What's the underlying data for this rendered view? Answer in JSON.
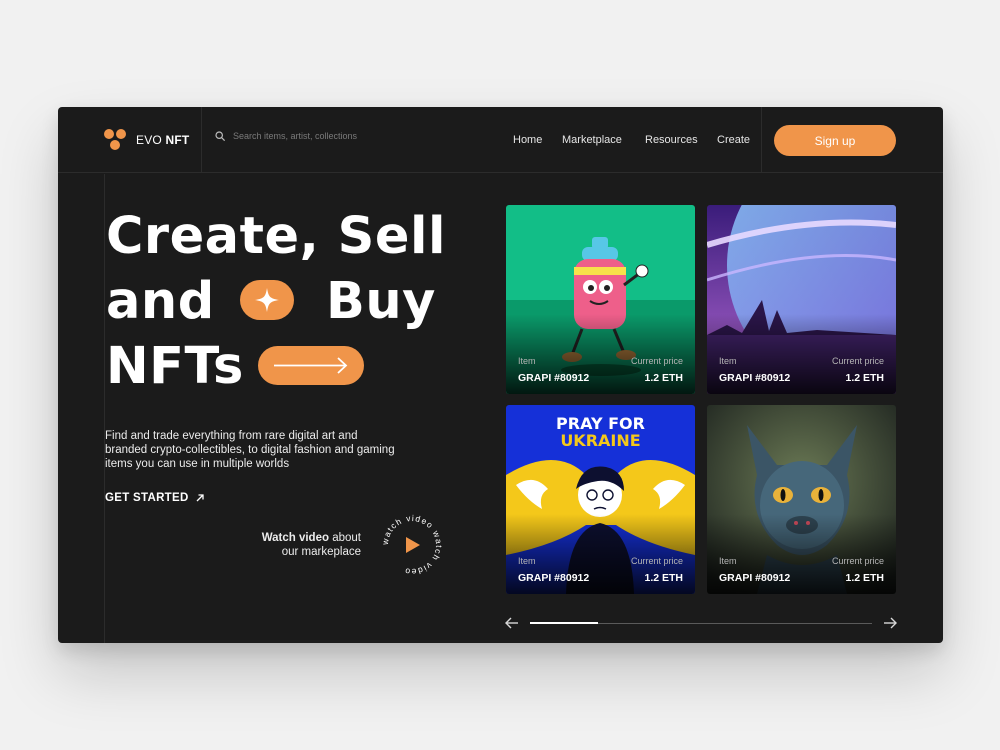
{
  "brand": {
    "name_light": "EVO",
    "name_bold": "NFT",
    "accent": "#f0954a"
  },
  "search": {
    "placeholder": "Search items, artist, collections"
  },
  "nav": {
    "items": [
      "Home",
      "Marketplace",
      "Resources",
      "Create"
    ]
  },
  "header": {
    "signup_label": "Sign up"
  },
  "hero": {
    "line1": "Create, Sell",
    "line2a": "and",
    "line2b": "Buy",
    "line3": "NFTs",
    "description": "Find and trade everything from rare digital art and branded crypto-collectibles, to digital fashion and gaming items you can use in multiple worlds",
    "cta_label": "GET STARTED",
    "watch_bold": "Watch video",
    "watch_rest": "about",
    "watch_line2": "our markeplace",
    "badge_text": "watch video watch video"
  },
  "cards": [
    {
      "item_label": "Item",
      "price_label": "Current price",
      "name": "GRAPI #80912",
      "price": "1.2 ETH",
      "bg": "#12be87"
    },
    {
      "item_label": "Item",
      "price_label": "Current price",
      "name": "GRAPI #80912",
      "price": "1.2 ETH",
      "bg": "#5a2d8a"
    },
    {
      "item_label": "Item",
      "price_label": "Current price",
      "name": "GRAPI #80912",
      "price": "1.2 ETH",
      "bg": "#1530d8",
      "poster_line1": "PRAY FOR",
      "poster_line2": "UKRAINE"
    },
    {
      "item_label": "Item",
      "price_label": "Current price",
      "name": "GRAPI #80912",
      "price": "1.2 ETH",
      "bg": "#3c4a3a"
    }
  ],
  "slider": {
    "progress": 0.2
  }
}
